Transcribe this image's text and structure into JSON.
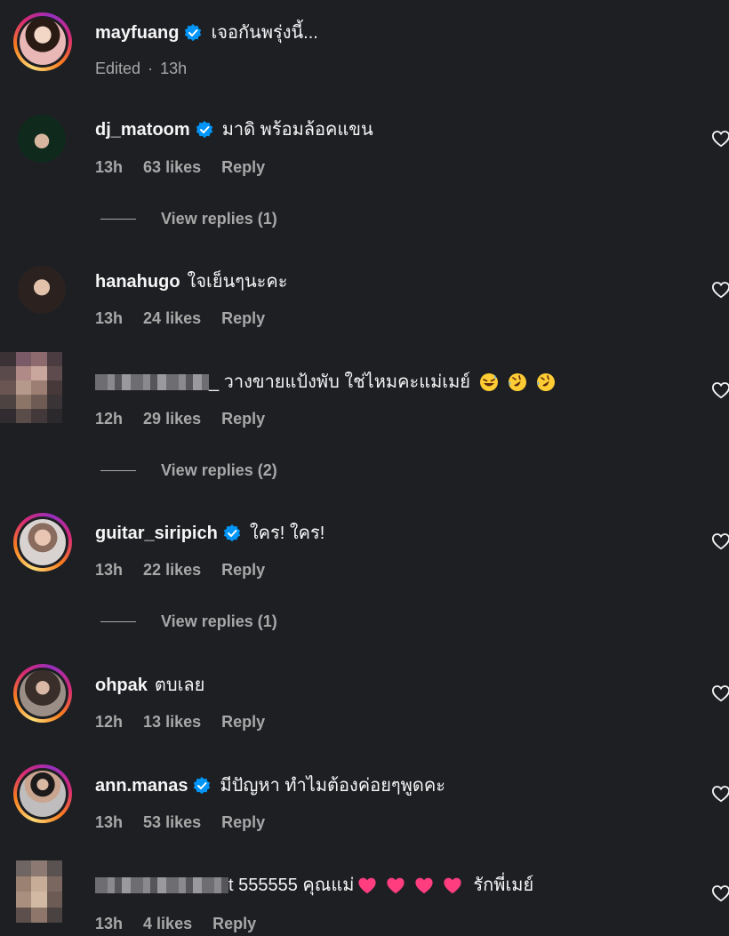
{
  "post_caption": {
    "username": "mayfuang",
    "verified": true,
    "text": "เจอกันพรุ่งนี้...",
    "edited_label": "Edited",
    "separator": "·",
    "time": "13h"
  },
  "comments": [
    {
      "username": "dj_matoom",
      "verified": true,
      "text": "มาดิ พร้อมล้อคแขน",
      "time": "13h",
      "likes": "63 likes",
      "reply": "Reply",
      "view_replies": "View replies (1)"
    },
    {
      "username": "hanahugo",
      "verified": false,
      "text": "ใจเย็นๆนะคะ",
      "time": "13h",
      "likes": "24 likes",
      "reply": "Reply"
    },
    {
      "username": "",
      "username_pixelated": true,
      "verified": false,
      "text": "_ วางขายแป้งพับ ใช่ไหมคะแม่เมย์",
      "emojis": [
        "grinning-sweat-emoji",
        "rofl-emoji",
        "rofl-emoji"
      ],
      "time": "12h",
      "likes": "29 likes",
      "reply": "Reply",
      "view_replies": "View replies (2)"
    },
    {
      "username": "guitar_siripich",
      "verified": true,
      "text": "ใคร! ใคร!",
      "time": "13h",
      "likes": "22 likes",
      "reply": "Reply",
      "view_replies": "View replies (1)"
    },
    {
      "username": "ohpak",
      "verified": false,
      "text": "ตบเลย",
      "time": "12h",
      "likes": "13 likes",
      "reply": "Reply"
    },
    {
      "username": "ann.manas",
      "verified": true,
      "text": "มีปัญหา ทำไมต้องค่อยๆพูดคะ",
      "time": "13h",
      "likes": "53 likes",
      "reply": "Reply"
    },
    {
      "username": "",
      "username_pixelated": true,
      "verified": false,
      "text_prefix": "t 555555 คุณแม่",
      "text_suffix": "รักพี่เมย์",
      "emojis": [
        "pink-heart-emoji",
        "pink-heart-emoji",
        "pink-heart-emoji",
        "pink-heart-emoji"
      ],
      "time": "13h",
      "likes": "4 likes",
      "reply": "Reply"
    }
  ],
  "colors": {
    "background": "#1e1f23",
    "text_primary": "#f5f5f5",
    "text_secondary": "#a8a8a8",
    "verified_blue": "#0095f6",
    "heart_emoji": "#ff3d7f"
  }
}
